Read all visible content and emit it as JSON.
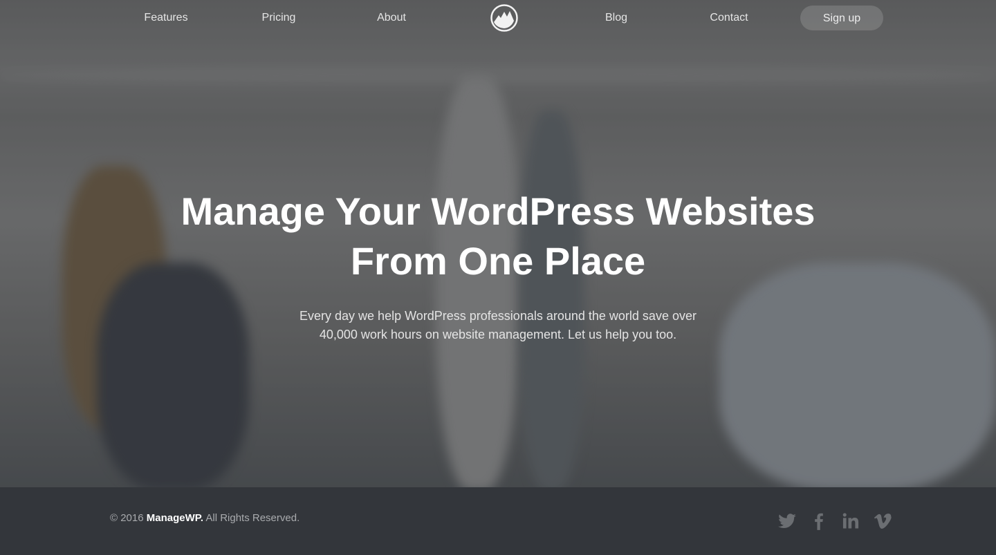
{
  "nav": {
    "items": [
      "Features",
      "Pricing",
      "About",
      "Blog",
      "Contact"
    ],
    "signup_label": "Sign up",
    "logo_icon": "mountain-logo-icon"
  },
  "hero": {
    "title_line1": "Manage Your WordPress Websites",
    "title_line2": "From One Place",
    "subtitle_line1": "Every day we help WordPress professionals around the world save over",
    "subtitle_line2": "40,000 work hours on website management. Let us help you too."
  },
  "footer": {
    "copyright_prefix": "© 2016",
    "brand": "ManageWP.",
    "copyright_suffix": "All Rights Reserved.",
    "social": [
      "twitter-icon",
      "facebook-icon",
      "linkedin-icon",
      "vimeo-icon"
    ],
    "background": "#33363b"
  }
}
